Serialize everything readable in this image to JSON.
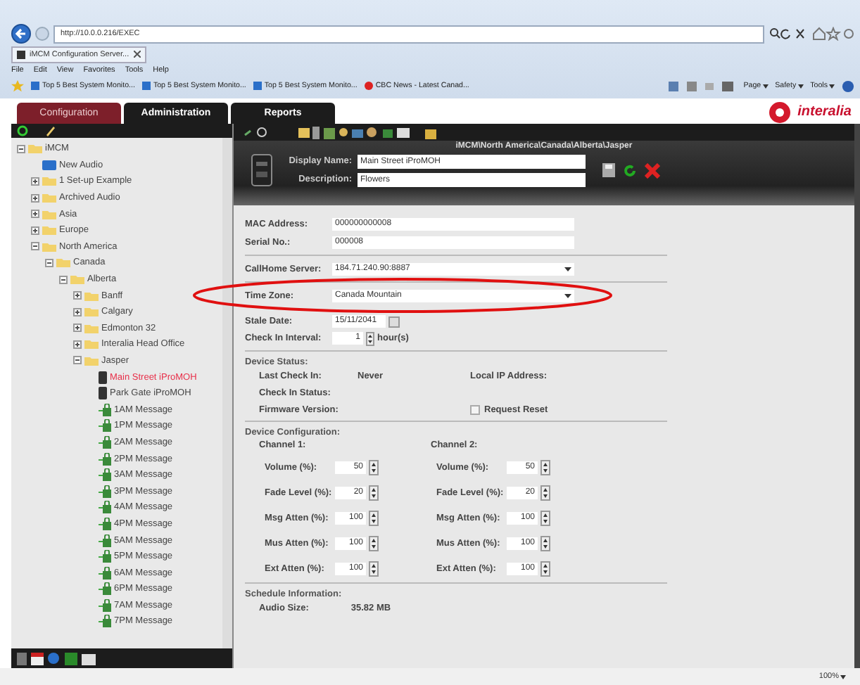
{
  "browser": {
    "address": "http://10.0.0.216/EXEC",
    "tab_title": "iMCM Configuration Server...",
    "menu": [
      "File",
      "Edit",
      "View",
      "Favorites",
      "Tools",
      "Help"
    ],
    "favorites": [
      "Top 5 Best System Monito...",
      "Top 5 Best System Monito...",
      "Top 5 Best System Monito...",
      "CBC News - Latest Canad..."
    ],
    "commands": [
      "Page",
      "Safety",
      "Tools"
    ],
    "zoom": "100%"
  },
  "app_tabs": [
    {
      "label": "Configuration",
      "selected": true
    },
    {
      "label": "Administration",
      "selected": false
    },
    {
      "label": "Reports",
      "selected": false
    }
  ],
  "logo": "interalia",
  "tree": [
    {
      "label": "iMCM",
      "kind": "folder",
      "expanded": true,
      "selected": false,
      "children": [
        {
          "label": "New Audio",
          "kind": "audio",
          "selected": false
        },
        {
          "label": "1 Set-up Example",
          "kind": "folder",
          "expanded": false,
          "selected": false
        },
        {
          "label": "Archived Audio",
          "kind": "folder",
          "expanded": false,
          "selected": false
        },
        {
          "label": "Asia",
          "kind": "folder",
          "expanded": false,
          "selected": false
        },
        {
          "label": "Europe",
          "kind": "folder",
          "expanded": false,
          "selected": false
        },
        {
          "label": "North America",
          "kind": "folder",
          "expanded": true,
          "selected": false,
          "children": [
            {
              "label": "Canada",
              "kind": "folder",
              "expanded": true,
              "selected": false,
              "children": [
                {
                  "label": "Alberta",
                  "kind": "folder",
                  "expanded": true,
                  "selected": false,
                  "children": [
                    {
                      "label": "Banff",
                      "kind": "folder",
                      "expanded": false,
                      "selected": false
                    },
                    {
                      "label": "Calgary",
                      "kind": "folder",
                      "expanded": false,
                      "selected": false
                    },
                    {
                      "label": "Edmonton 32",
                      "kind": "folder",
                      "expanded": false,
                      "selected": false
                    },
                    {
                      "label": "Interalia Head Office",
                      "kind": "folder",
                      "expanded": false,
                      "selected": false
                    },
                    {
                      "label": "Jasper",
                      "kind": "folder",
                      "expanded": true,
                      "selected": false,
                      "children": [
                        {
                          "label": "Main Street iProMOH",
                          "kind": "device",
                          "selected": true
                        },
                        {
                          "label": "Park Gate iProMOH",
                          "kind": "device",
                          "selected": false
                        },
                        {
                          "label": "1AM Message",
                          "kind": "message",
                          "selected": false
                        },
                        {
                          "label": "1PM Message",
                          "kind": "message",
                          "selected": false
                        },
                        {
                          "label": "2AM Message",
                          "kind": "message",
                          "selected": false
                        },
                        {
                          "label": "2PM Message",
                          "kind": "message",
                          "selected": false
                        },
                        {
                          "label": "3AM Message",
                          "kind": "message",
                          "selected": false
                        },
                        {
                          "label": "3PM Message",
                          "kind": "message",
                          "selected": false
                        },
                        {
                          "label": "4AM Message",
                          "kind": "message",
                          "selected": false
                        },
                        {
                          "label": "4PM Message",
                          "kind": "message",
                          "selected": false
                        },
                        {
                          "label": "5AM Message",
                          "kind": "message",
                          "selected": false
                        },
                        {
                          "label": "5PM Message",
                          "kind": "message",
                          "selected": false
                        },
                        {
                          "label": "6AM Message",
                          "kind": "message",
                          "selected": false
                        },
                        {
                          "label": "6PM Message",
                          "kind": "message",
                          "selected": false
                        },
                        {
                          "label": "7AM Message",
                          "kind": "message",
                          "selected": false
                        },
                        {
                          "label": "7PM Message",
                          "kind": "message",
                          "selected": false
                        }
                      ]
                    }
                  ]
                }
              ]
            }
          ]
        }
      ]
    }
  ],
  "details": {
    "path": "iMCM\\North America\\Canada\\Alberta\\Jasper",
    "display_name": {
      "label": "Display Name:",
      "value": "Main Street iProMOH"
    },
    "description": {
      "label": "Description:",
      "value": "Flowers"
    },
    "identity": [
      {
        "label": "MAC Address:",
        "value": "000000000008"
      },
      {
        "label": "Serial No.:",
        "value": "000008"
      }
    ],
    "callhome": {
      "label": "CallHome Server:",
      "value": "184.71.240.90:8887"
    },
    "time_zone": {
      "label": "Time Zone:",
      "value": "Canada Mountain"
    },
    "stale_date": {
      "label": "Stale Date:",
      "value": "15/11/2041"
    },
    "check_in_interval": {
      "label": "Check In Interval:",
      "value": "1",
      "unit": "hour(s)"
    },
    "device_status": {
      "title": "Device Status:",
      "last_check_in": {
        "label": "Last Check In:",
        "value": "Never"
      },
      "local_ip": {
        "label": "Local IP Address:"
      },
      "check_in_status": {
        "label": "Check In Status:"
      },
      "firmware": {
        "label": "Firmware Version:"
      },
      "request_reset": {
        "label": "Request Reset",
        "checked": false
      }
    },
    "device_configuration": {
      "title": "Device Configuration:",
      "channels": [
        {
          "title": "Channel 1:",
          "settings": [
            {
              "label": "Volume (%):",
              "value": "50"
            },
            {
              "label": "Fade Level (%):",
              "value": "20"
            },
            {
              "label": "Msg Atten (%):",
              "value": "100"
            },
            {
              "label": "Mus Atten (%):",
              "value": "100"
            },
            {
              "label": "Ext Atten (%):",
              "value": "100"
            }
          ]
        },
        {
          "title": "Channel 2:",
          "settings": [
            {
              "label": "Volume (%):",
              "value": "50"
            },
            {
              "label": "Fade Level (%):",
              "value": "20"
            },
            {
              "label": "Msg Atten (%):",
              "value": "100"
            },
            {
              "label": "Mus Atten (%):",
              "value": "100"
            },
            {
              "label": "Ext Atten (%):",
              "value": "100"
            }
          ]
        }
      ]
    },
    "schedule": {
      "title": "Schedule Information:",
      "audio_size": {
        "label": "Audio Size:",
        "value": "35.82 MB"
      }
    }
  }
}
